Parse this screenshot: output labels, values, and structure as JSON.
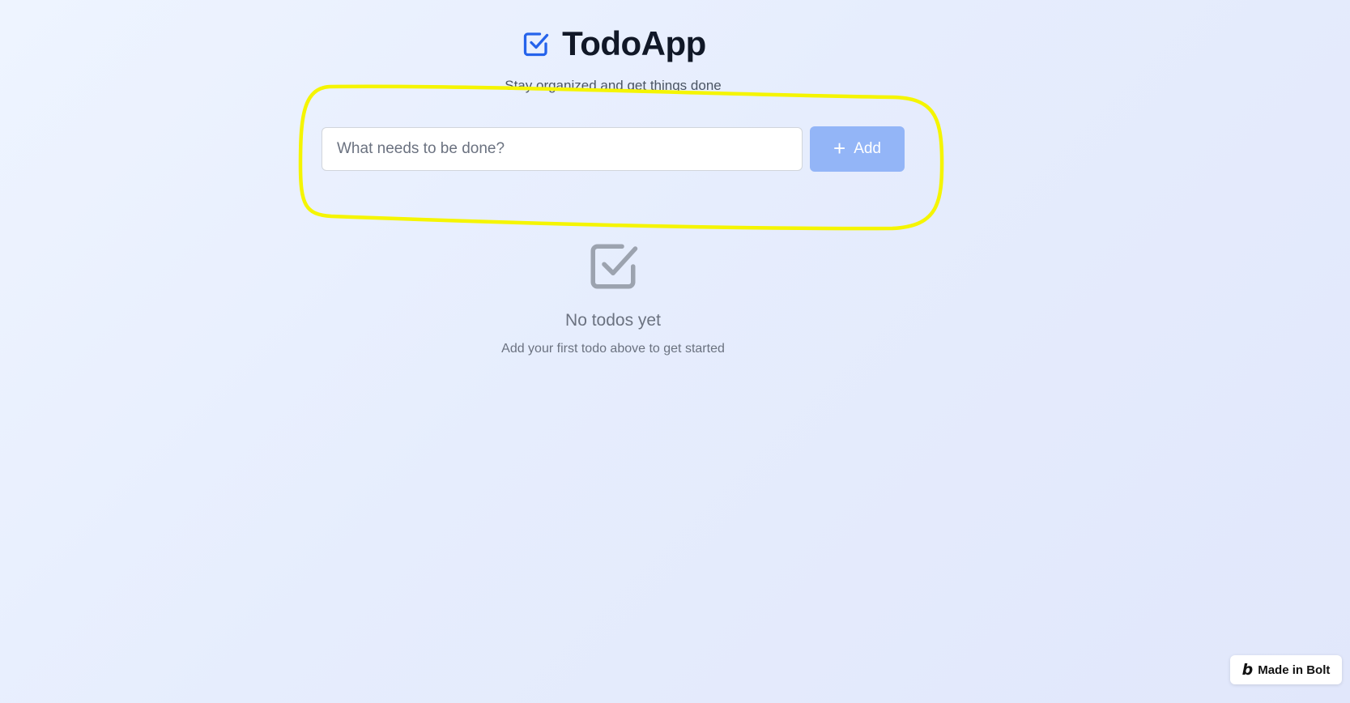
{
  "app": {
    "title": "TodoApp",
    "subtitle": "Stay organized and get things done",
    "logo_icon": "checkbox-checked-icon"
  },
  "form": {
    "input_value": "",
    "input_placeholder": "What needs to be done?",
    "add_button_label": "Add",
    "add_icon": "plus-icon"
  },
  "empty_state": {
    "icon": "checkbox-checked-icon",
    "title": "No todos yet",
    "description": "Add your first todo above to get started"
  },
  "badge": {
    "label": "Made in Bolt",
    "logo_glyph": "b"
  },
  "colors": {
    "accent": "#2563eb",
    "button_disabled": "#93b5f7",
    "highlight": "#f5f500"
  }
}
